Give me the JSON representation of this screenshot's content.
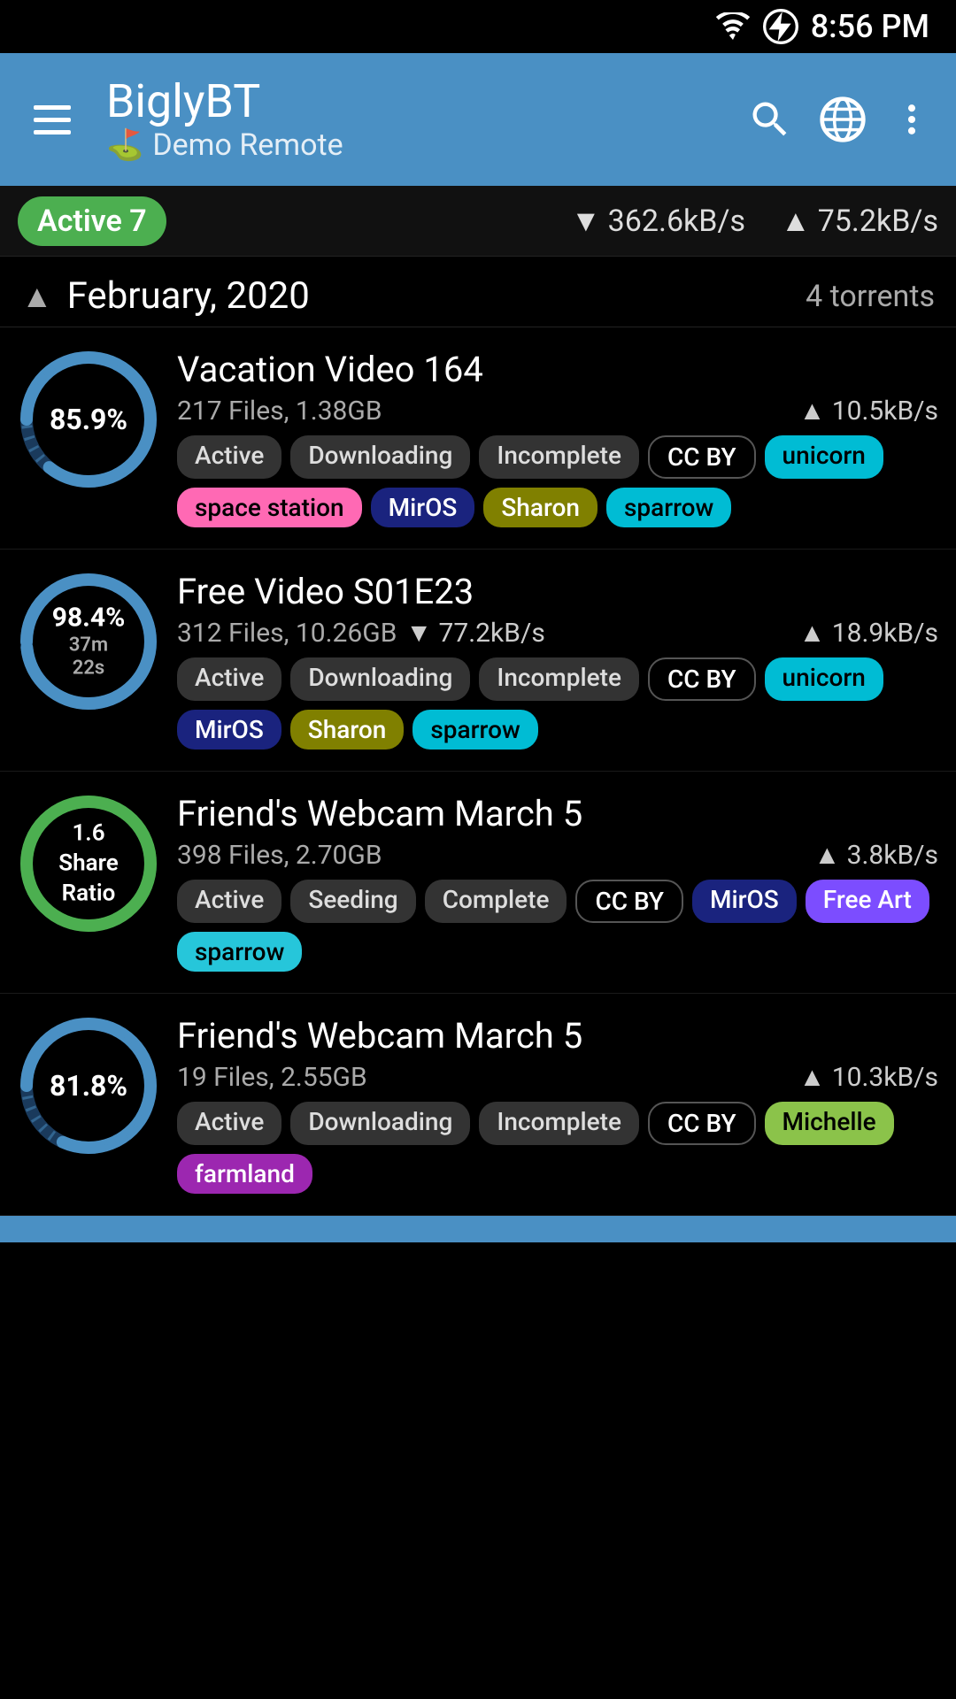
{
  "statusBar": {
    "time": "8:56 PM"
  },
  "appBar": {
    "title": "BiglyBT",
    "subtitle": "Demo Remote",
    "flagIcon": "⛳"
  },
  "activeBar": {
    "badge": "Active 7",
    "downloadSpeed": "362.6kB/s",
    "uploadSpeed": "75.2kB/s",
    "downArrow": "▼",
    "upArrow": "▲"
  },
  "sectionHeader": {
    "title": "February, 2020",
    "count": "4 torrents"
  },
  "torrents": [
    {
      "id": "t1",
      "progress": 85.9,
      "progressLabel": "85.9%",
      "isSharing": false,
      "name": "Vacation Video 164",
      "files": "217 Files, 1.38GB",
      "speed": "▲ 10.5kB/s",
      "hasTimer": false,
      "tags": [
        {
          "label": "Active",
          "class": "tag-dark"
        },
        {
          "label": "Downloading",
          "class": "tag-dark"
        },
        {
          "label": "Incomplete",
          "class": "tag-dark"
        },
        {
          "label": "CC BY",
          "class": "tag-black"
        },
        {
          "label": "unicorn",
          "class": "tag-cyan"
        },
        {
          "label": "space station",
          "class": "tag-pink"
        },
        {
          "label": "MirOS",
          "class": "tag-blue"
        },
        {
          "label": "Sharon",
          "class": "tag-olive"
        },
        {
          "label": "sparrow",
          "class": "tag-teal"
        }
      ],
      "circleColor": "#4a90c4",
      "trackColor": "#1a3a5c",
      "dashed": true
    },
    {
      "id": "t2",
      "progress": 98.4,
      "progressLabel": "98.4%",
      "subLabel": "37m 22s",
      "isSharing": false,
      "name": "Free Video S01E23",
      "files": "312 Files, 10.26GB",
      "speed": "▲ 18.9kB/s",
      "downloadSpeed": "▼ 77.2kB/s",
      "hasTimer": true,
      "tags": [
        {
          "label": "Active",
          "class": "tag-dark"
        },
        {
          "label": "Downloading",
          "class": "tag-dark"
        },
        {
          "label": "Incomplete",
          "class": "tag-dark"
        },
        {
          "label": "CC BY",
          "class": "tag-black"
        },
        {
          "label": "unicorn",
          "class": "tag-cyan"
        },
        {
          "label": "MirOS",
          "class": "tag-blue"
        },
        {
          "label": "Sharon",
          "class": "tag-olive"
        },
        {
          "label": "sparrow",
          "class": "tag-teal"
        }
      ],
      "circleColor": "#4a90c4",
      "trackColor": "#1a3a5c",
      "dashed": false
    },
    {
      "id": "t3",
      "progress": 100,
      "progressLabel": "1.6\nShare\nRatio",
      "isSharing": true,
      "name": "Friend's Webcam March 5",
      "files": "398 Files, 2.70GB",
      "speed": "▲ 3.8kB/s",
      "hasTimer": false,
      "tags": [
        {
          "label": "Active",
          "class": "tag-dark"
        },
        {
          "label": "Seeding",
          "class": "tag-dark"
        },
        {
          "label": "Complete",
          "class": "tag-dark"
        },
        {
          "label": "CC BY",
          "class": "tag-black"
        },
        {
          "label": "MirOS",
          "class": "tag-blue"
        },
        {
          "label": "Free Art",
          "class": "tag-purple"
        },
        {
          "label": "sparrow",
          "class": "tag-green"
        }
      ],
      "circleColor": "#4caf50",
      "trackColor": "#1b5e20",
      "dashed": false
    },
    {
      "id": "t4",
      "progress": 81.8,
      "progressLabel": "81.8%",
      "isSharing": false,
      "name": "Friend's Webcam March 5",
      "files": "19 Files, 2.55GB",
      "speed": "▲ 10.3kB/s",
      "hasTimer": false,
      "tags": [
        {
          "label": "Active",
          "class": "tag-dark"
        },
        {
          "label": "Downloading",
          "class": "tag-dark"
        },
        {
          "label": "Incomplete",
          "class": "tag-dark"
        },
        {
          "label": "CC BY",
          "class": "tag-black"
        },
        {
          "label": "Michelle",
          "class": "tag-michelle"
        },
        {
          "label": "farmland",
          "class": "tag-farmland"
        }
      ],
      "circleColor": "#4a90c4",
      "trackColor": "#1a3a5c",
      "dashed": true
    }
  ],
  "labels": {
    "menu": "menu",
    "search": "search",
    "globe": "globe",
    "more": "more options"
  }
}
